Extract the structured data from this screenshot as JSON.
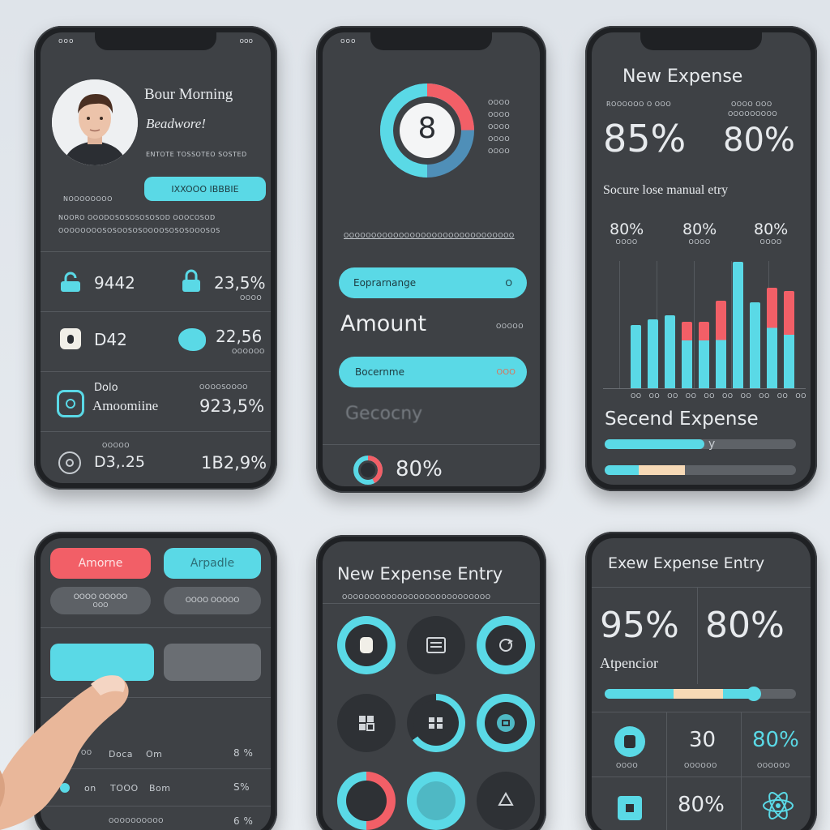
{
  "colors": {
    "cyan": "#5ad9e6",
    "red": "#f25f67",
    "screen": "#3e4145",
    "frame": "#1f2124",
    "cream": "#f6d9b6"
  },
  "phone1": {
    "status_left": "ooo",
    "status_right": "ooo",
    "greeting": "Bour Morning",
    "welcome": "Beadwore!",
    "subtitle": "ENTOTE TOSSOTEO SOSTED",
    "action_button": "IXXOOO IBBBIE",
    "section_label": "NOOOOOOOO",
    "desc_line1": "NOORO OOODOSOSOSOSOSOD OOOCOSOD",
    "desc_line2": "OOOOOOOOSOSOOSOSOOOOSOSOSOOOSOS",
    "rows": [
      {
        "left": "9442",
        "right": "23,5%",
        "right_sub": "OOOO"
      },
      {
        "left": "D42",
        "right": "22,56",
        "right_sub": "OOOOOO"
      },
      {
        "left_top": "Dolo",
        "left": "Amoomiine",
        "right_top": "OOOOSOOOO",
        "right": "923,5%"
      },
      {
        "left_top": "OOOOO",
        "left": "D3,.25",
        "right": "1B2,9%"
      }
    ]
  },
  "phone2": {
    "status_left": "ooo",
    "ring_value": "8",
    "side_lines": [
      "OOOO",
      "OOOO",
      "OOOO",
      "OOOO",
      "OOOO"
    ],
    "divider_text": "OOOOOOOOOOOOOOOOOOOOOOOOOOOOOOO",
    "field1": "Eoprarnange",
    "field1_icon": "O",
    "amount_label": "Amount",
    "amount_hint": "OOOOO",
    "field2": "Bocernme",
    "field2_tag": "OOO",
    "category_placeholder": "Gecocny",
    "footer_percent": "80%"
  },
  "phone3": {
    "title": "New Expense",
    "sub_left": "ROOOOOO O OOO",
    "sub_right": "OOOO OOO",
    "sub_right2": "OOOOOOOOO",
    "big_left": "85%",
    "big_right": "80%",
    "caption": "Socure lose manual etry",
    "mini": [
      {
        "v": "80%",
        "s": "OOOO"
      },
      {
        "v": "80%",
        "s": "OOOO"
      },
      {
        "v": "80%",
        "s": "OOOO"
      }
    ],
    "chart_ticks": [
      "OO",
      "OO",
      "OO",
      "OO",
      "OO",
      "OO",
      "OO",
      "OO",
      "OO",
      "OO"
    ],
    "second_title": "Secend Expense",
    "slider_mark": "y"
  },
  "phone4": {
    "btn_red": "Amorne",
    "btn_cyan": "Arpadle",
    "chip_left": "OOOO OOOOO",
    "chip_left_sub": "OOO",
    "chip_right": "OOOO OOOOO",
    "list": [
      {
        "a": "OO",
        "b": "Doca",
        "c": "Om",
        "v": "8 %"
      },
      {
        "a": "on",
        "b": "TOOO",
        "c": "Bom",
        "v": "S%"
      },
      {
        "a": "OO",
        "b": "OOOOOOOOOO",
        "c": "",
        "v": "6 %"
      }
    ]
  },
  "phone5": {
    "title": "New Expense Entry",
    "sub": "OOOOOOOOOOOOOOOOOOOOOOOOOOO"
  },
  "phone6": {
    "title": "Exew Expense Entry",
    "big_left": "95%",
    "big_right": "80%",
    "label": "Atpencior",
    "tiles": [
      {
        "v": "",
        "s": "OOOO"
      },
      {
        "v": "30",
        "s": "OOOOOO"
      },
      {
        "v": "80%",
        "s": "OOOOOO"
      },
      {
        "v": "",
        "s": ""
      },
      {
        "v": "80%",
        "s": ""
      },
      {
        "v": "",
        "s": ""
      }
    ]
  }
}
